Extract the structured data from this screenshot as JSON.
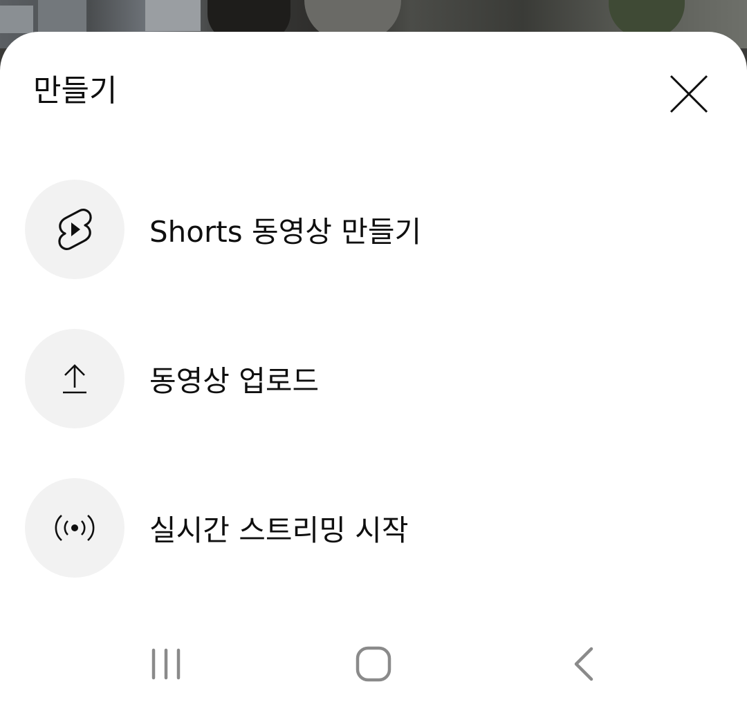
{
  "sheet": {
    "title": "만들기",
    "close_icon": "close-icon"
  },
  "menu": {
    "items": [
      {
        "label": "Shorts 동영상 만들기",
        "icon": "shorts-icon"
      },
      {
        "label": "동영상 업로드",
        "icon": "upload-icon"
      },
      {
        "label": "실시간 스트리밍 시작",
        "icon": "live-broadcast-icon"
      }
    ]
  },
  "nav": {
    "recent_icon": "recent-apps-icon",
    "home_icon": "home-icon",
    "back_icon": "back-icon"
  },
  "colors": {
    "sheet_bg": "#ffffff",
    "icon_circle_bg": "#f2f2f2",
    "text": "#0f0f0f",
    "nav_icon": "#8a8a8a"
  }
}
